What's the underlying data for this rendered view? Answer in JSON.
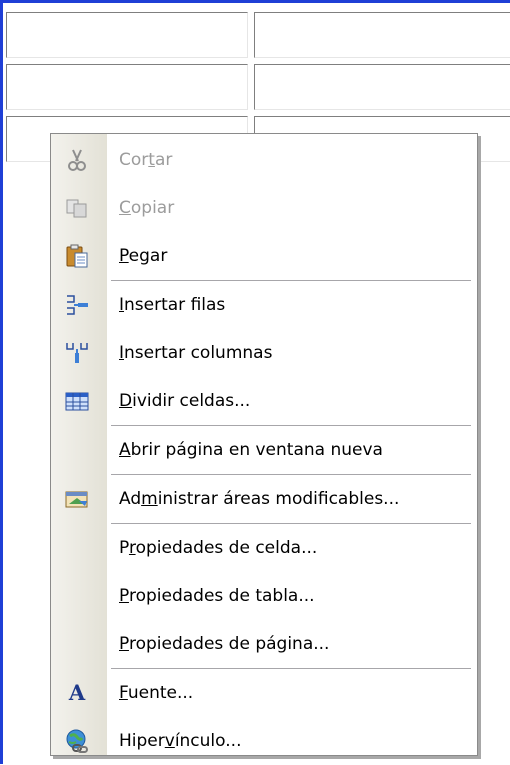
{
  "menu": {
    "items": [
      {
        "pre": "Cor",
        "acc": "t",
        "post": "ar",
        "enabled": false,
        "icon": "scissors-icon"
      },
      {
        "pre": "",
        "acc": "C",
        "post": "opiar",
        "enabled": false,
        "icon": "copy-icon"
      },
      {
        "pre": "",
        "acc": "P",
        "post": "egar",
        "enabled": true,
        "icon": "paste-icon"
      },
      {
        "pre": "",
        "acc": "I",
        "post": "nsertar filas",
        "enabled": true,
        "icon": "insert-rows-icon"
      },
      {
        "pre": "",
        "acc": "I",
        "post": "nsertar columnas",
        "enabled": true,
        "icon": "insert-columns-icon"
      },
      {
        "pre": "",
        "acc": "D",
        "post": "ividir celdas...",
        "enabled": true,
        "icon": "split-cells-icon"
      },
      {
        "pre": "",
        "acc": "A",
        "post": "brir página en ventana nueva",
        "enabled": true,
        "icon": ""
      },
      {
        "pre": "Ad",
        "acc": "m",
        "post": "inistrar áreas modificables...",
        "enabled": true,
        "icon": "manage-areas-icon"
      },
      {
        "pre": "P",
        "acc": "r",
        "post": "opiedades de celda...",
        "enabled": true,
        "icon": ""
      },
      {
        "pre": "",
        "acc": "P",
        "post": "ropiedades de tabla...",
        "enabled": true,
        "icon": ""
      },
      {
        "pre": "",
        "acc": "P",
        "post": "ropiedades de página...",
        "enabled": true,
        "icon": ""
      },
      {
        "pre": "",
        "acc": "F",
        "post": "uente...",
        "enabled": true,
        "icon": "font-icon"
      },
      {
        "pre": "Hiper",
        "acc": "v",
        "post": "ínculo...",
        "enabled": true,
        "icon": "hyperlink-icon"
      }
    ]
  }
}
